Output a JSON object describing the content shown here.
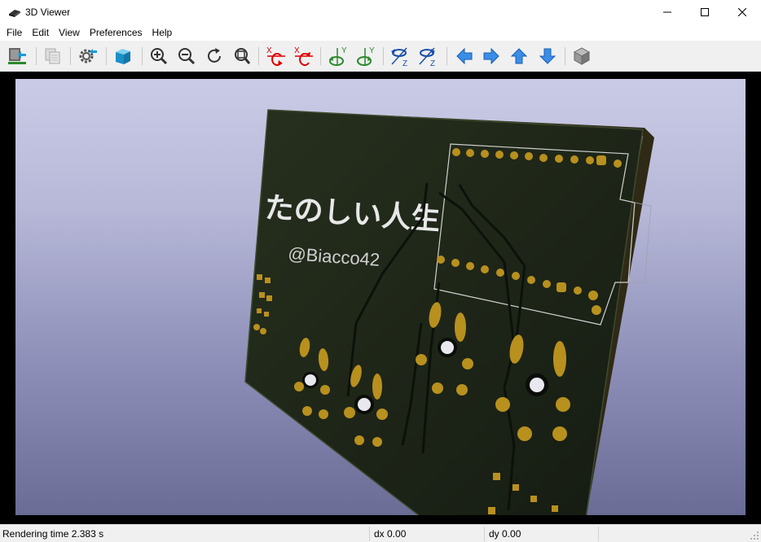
{
  "window": {
    "title": "3D Viewer",
    "icon": "kicad-3d-icon"
  },
  "menu": [
    "File",
    "Edit",
    "View",
    "Preferences",
    "Help"
  ],
  "toolbar": {
    "items": [
      "reload-board-icon",
      "copy-image-icon",
      "settings-icon",
      "render-mode-icon",
      "zoom-in-icon",
      "zoom-out-icon",
      "redraw-icon",
      "zoom-fit-icon",
      "rotate-x-cw-icon",
      "rotate-x-ccw-icon",
      "rotate-y-cw-icon",
      "rotate-y-ccw-icon",
      "rotate-z-cw-icon",
      "rotate-z-ccw-icon",
      "pan-left-icon",
      "pan-right-icon",
      "pan-up-icon",
      "pan-down-icon",
      "ortho-view-icon"
    ]
  },
  "board": {
    "silk_title": "たのしい人生",
    "silk_handle": "@Biacco42"
  },
  "colors": {
    "pad": "#b8901e",
    "board": "#1c2417",
    "bg_top": "#cacbe6",
    "bg_bottom": "#6a6c96",
    "silk": "#e8e8e8"
  },
  "status": {
    "render_time": "Rendering time 2.383 s",
    "dx": "dx 0.00",
    "dy": "dy 0.00"
  }
}
